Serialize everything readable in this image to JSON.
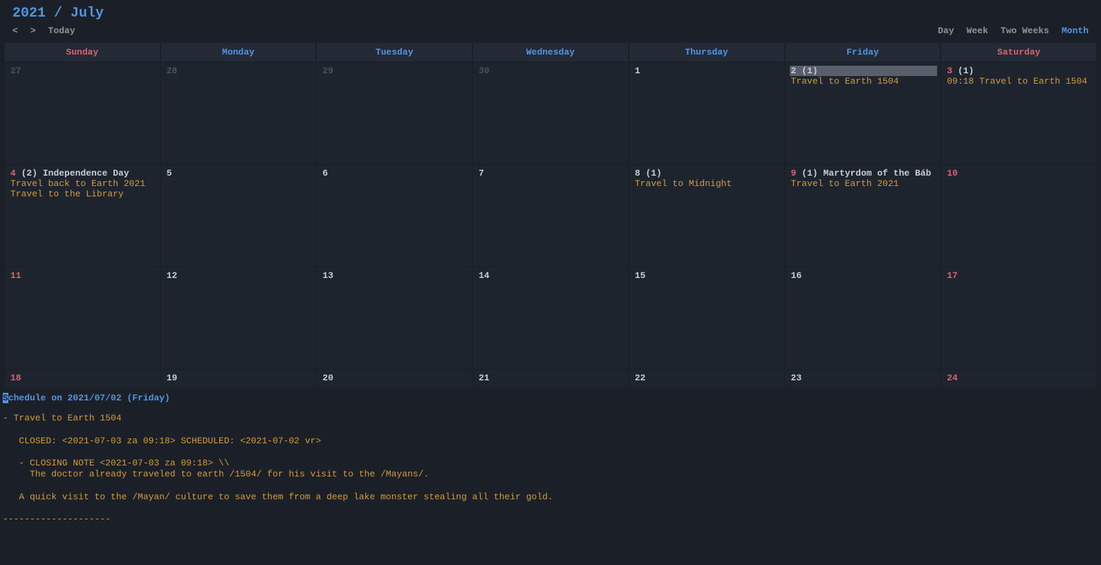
{
  "header": {
    "title": "2021 / July"
  },
  "nav": {
    "prev": "<",
    "next": ">",
    "today": "Today"
  },
  "views": {
    "day": "Day",
    "week": "Week",
    "two_weeks": "Two Weeks",
    "month": "Month",
    "active": "month"
  },
  "weekdays": {
    "sun": "Sunday",
    "mon": "Monday",
    "tue": "Tuesday",
    "wed": "Wednesday",
    "thu": "Thursday",
    "fri": "Friday",
    "sat": "Saturday"
  },
  "cells": {
    "r0": {
      "sun": {
        "num": "27"
      },
      "mon": {
        "num": "28"
      },
      "tue": {
        "num": "29"
      },
      "wed": {
        "num": "30"
      },
      "thu": {
        "num": "1"
      },
      "fri": {
        "num": "2",
        "count": "(1)",
        "ev1": "Travel to Earth 1504"
      },
      "sat": {
        "num": "3",
        "count": "(1)",
        "ev1": "09:18 Travel to Earth 1504"
      }
    },
    "r1": {
      "sun": {
        "num": "4",
        "count": "(2)",
        "holiday": "Independence Day",
        "ev1": "Travel back to Earth 2021",
        "ev2": "Travel to the Library"
      },
      "mon": {
        "num": "5"
      },
      "tue": {
        "num": "6"
      },
      "wed": {
        "num": "7"
      },
      "thu": {
        "num": "8",
        "count": "(1)",
        "ev1": "Travel to Midnight"
      },
      "fri": {
        "num": "9",
        "count": "(1)",
        "holiday": "Martyrdom of the Báb",
        "ev1": "Travel to Earth 2021"
      },
      "sat": {
        "num": "10"
      }
    },
    "r2": {
      "sun": {
        "num": "11"
      },
      "mon": {
        "num": "12"
      },
      "tue": {
        "num": "13"
      },
      "wed": {
        "num": "14"
      },
      "thu": {
        "num": "15"
      },
      "fri": {
        "num": "16"
      },
      "sat": {
        "num": "17"
      }
    },
    "r3": {
      "sun": {
        "num": "18"
      },
      "mon": {
        "num": "19"
      },
      "tue": {
        "num": "20"
      },
      "wed": {
        "num": "21"
      },
      "thu": {
        "num": "22"
      },
      "fri": {
        "num": "23"
      },
      "sat": {
        "num": "24"
      }
    }
  },
  "schedule": {
    "title_rest": "chedule on 2021/07/02 (Friday)",
    "title_cursor": "S",
    "body": "- Travel to Earth 1504\n\n   CLOSED: <2021-07-03 za 09:18> SCHEDULED: <2021-07-02 vr>\n\n   - CLOSING NOTE <2021-07-03 za 09:18> \\\\\n     The doctor already traveled to earth /1504/ for his visit to the /Mayans/.\n\n   A quick visit to the /Mayan/ culture to save them from a deep lake monster stealing all their gold.\n\n--------------------"
  }
}
